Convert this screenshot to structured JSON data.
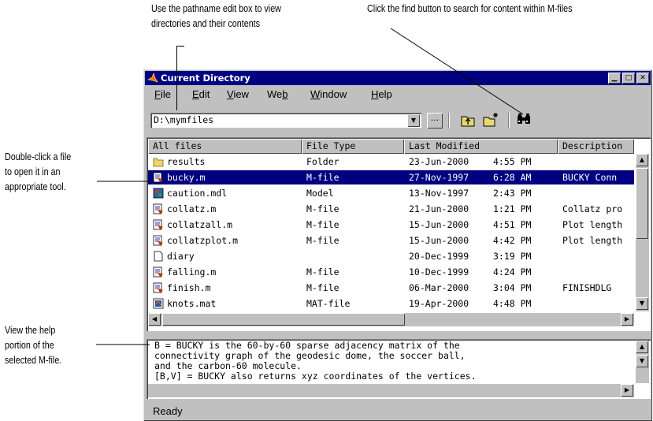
{
  "callouts": {
    "pathname": [
      "Use the pathname edit box to view",
      "directories and their contents"
    ],
    "find": "Click the find button to search for content within M-files",
    "double_click": [
      "Double-click a file",
      "to open it in an",
      "appropriate tool."
    ],
    "help": [
      "View the help",
      "portion of the",
      "selected M-file."
    ]
  },
  "window": {
    "title": "Current Directory",
    "menu": [
      {
        "label": "File",
        "underline": "F"
      },
      {
        "label": "Edit",
        "underline": "E"
      },
      {
        "label": "View",
        "underline": "V"
      },
      {
        "label": "Web",
        "underline": "b"
      },
      {
        "label": "Window",
        "underline": "W"
      },
      {
        "label": "Help",
        "underline": "H"
      }
    ],
    "path_value": "D:\\mymfiles",
    "browse_label": "...",
    "columns": [
      "All files",
      "File Type",
      "Last Modified",
      "Description"
    ],
    "files": [
      {
        "name": "results",
        "type": "Folder",
        "date": "23-Jun-2000",
        "time": "4:55 PM",
        "desc": "",
        "icon": "folder-icon",
        "selected": false
      },
      {
        "name": "bucky.m",
        "type": "M-file",
        "date": "27-Nov-1997",
        "time": "6:28 AM",
        "desc": "BUCKY  Conn",
        "icon": "m-file-icon",
        "selected": true
      },
      {
        "name": "caution.mdl",
        "type": "Model",
        "date": "13-Nov-1997",
        "time": "2:43 PM",
        "desc": "",
        "icon": "model-file-icon",
        "selected": false
      },
      {
        "name": "collatz.m",
        "type": "M-file",
        "date": "21-Jun-2000",
        "time": "1:21 PM",
        "desc": "Collatz pro",
        "icon": "m-file-icon",
        "selected": false
      },
      {
        "name": "collatzall.m",
        "type": "M-file",
        "date": "15-Jun-2000",
        "time": "4:51 PM",
        "desc": "Plot length",
        "icon": "m-file-icon",
        "selected": false
      },
      {
        "name": "collatzplot.m",
        "type": "M-file",
        "date": "15-Jun-2000",
        "time": "4:42 PM",
        "desc": "Plot length",
        "icon": "m-file-icon",
        "selected": false
      },
      {
        "name": "diary",
        "type": "",
        "date": "20-Dec-1999",
        "time": "3:19 PM",
        "desc": "",
        "icon": "text-file-icon",
        "selected": false
      },
      {
        "name": "falling.m",
        "type": "M-file",
        "date": "10-Dec-1999",
        "time": "4:24 PM",
        "desc": "",
        "icon": "m-file-icon",
        "selected": false
      },
      {
        "name": "finish.m",
        "type": "M-file",
        "date": "06-Mar-2000",
        "time": "3:04 PM",
        "desc": "FINISHDLG",
        "icon": "m-file-icon",
        "selected": false
      },
      {
        "name": "knots.mat",
        "type": "MAT-file",
        "date": "19-Apr-2000",
        "time": "4:48 PM",
        "desc": "",
        "icon": "mat-file-icon",
        "selected": false
      }
    ],
    "help_text": "B = BUCKY is the 60-by-60 sparse adjacency matrix of the\nconnectivity graph of the geodesic dome, the soccer ball,\nand the carbon-60 molecule.\n[B,V] = BUCKY also returns xyz coordinates of the vertices.",
    "status": "Ready",
    "colors": {
      "titlebar": "#000080",
      "chrome": "#c0c0c0",
      "selection": "#000080"
    }
  }
}
